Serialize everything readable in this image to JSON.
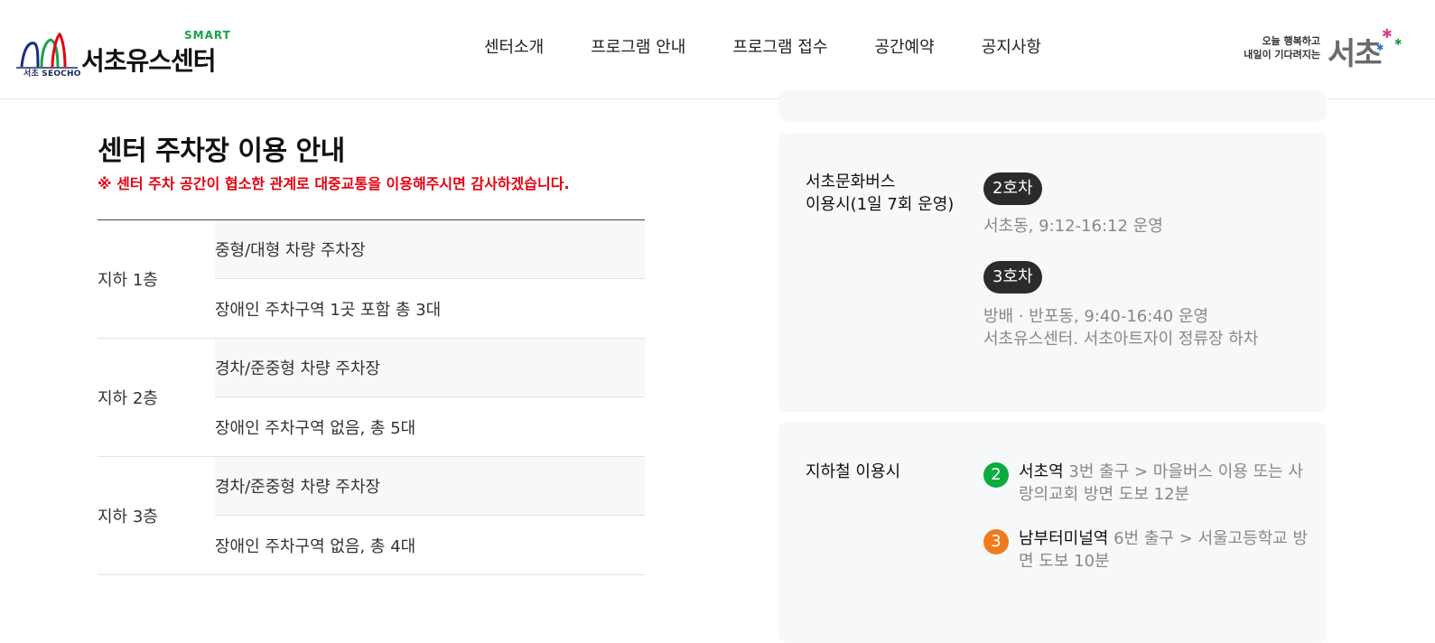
{
  "header": {
    "logo_sub": "서초 SEOCHO",
    "logo_smart": "SMART",
    "logo_name": "서초유스센터",
    "nav": [
      "센터소개",
      "프로그램 안내",
      "프로그램 접수",
      "공간예약",
      "공지사항"
    ],
    "brand_tagline_1": "오늘 행복하고",
    "brand_tagline_2": "내일이 기다려지는",
    "brand_name": "서초"
  },
  "colors": {
    "notice_red": "#e4000f",
    "line2_green": "#0aad3c",
    "line3_orange": "#ef7c1c",
    "badge_dark": "#2b2b2b",
    "panel_bg": "#f7f8fa"
  },
  "parking": {
    "title": "센터 주차장 이용 안내",
    "notice": "※ 센터 주차 공간이 협소한 관계로 대중교통을 이용해주시면 감사하겠습니다.",
    "floors": [
      {
        "label": "지하 1층",
        "rows": [
          "중형/대형 차량 주차장",
          "장애인 주차구역 1곳 포함 총 3대"
        ]
      },
      {
        "label": "지하 2층",
        "rows": [
          "경차/준중형 차량 주차장",
          "장애인 주차구역 없음, 총 5대"
        ]
      },
      {
        "label": "지하 3층",
        "rows": [
          "경차/준중형 차량 주차장",
          "장애인 주차구역 없음, 총 4대"
        ]
      }
    ]
  },
  "bus": {
    "label_1": "서초문화버스",
    "label_2": "이용시(1일 7회 운영)",
    "routes": [
      {
        "badge": "2호차",
        "lines": [
          "서초동, 9:12-16:12 운영"
        ]
      },
      {
        "badge": "3호차",
        "lines": [
          "방배 · 반포동, 9:40-16:40 운영",
          "서초유스센터. 서초아트자이 정류장 하차"
        ]
      }
    ]
  },
  "subway": {
    "label": "지하철 이용시",
    "items": [
      {
        "line": "2",
        "station": "서초역",
        "desc": " 3번 출구 > 마을버스 이용 또는 사랑의교회 방면 도보 12분"
      },
      {
        "line": "3",
        "station": "남부터미널역",
        "desc": " 6번 출구 > 서울고등학교 방면 도보 10분"
      }
    ]
  }
}
